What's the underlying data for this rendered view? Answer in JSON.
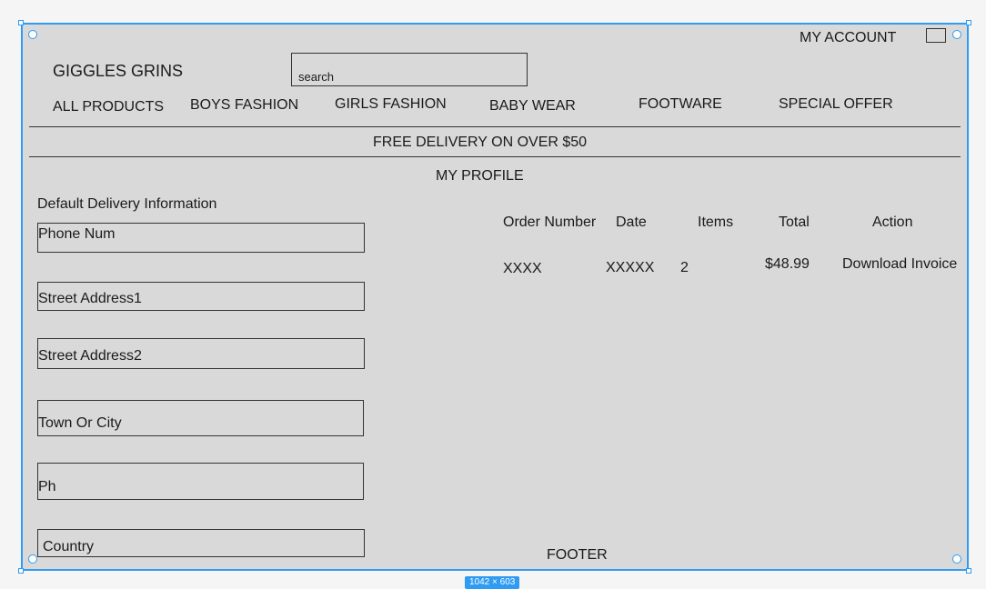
{
  "header": {
    "my_account": "MY ACCOUNT",
    "logo": "GIGGLES GRINS",
    "search_placeholder": "search"
  },
  "nav": {
    "items": [
      "ALL PRODUCTS",
      "BOYS FASHION",
      "GIRLS FASHION",
      "BABY WEAR",
      "FOOTWARE",
      "SPECIAL OFFER"
    ]
  },
  "banner": "FREE DELIVERY ON OVER $50",
  "profile": {
    "title": "MY PROFILE",
    "delivery_heading": "Default Delivery Information",
    "fields": [
      "Phone Num",
      "Street Address1",
      "Street Address2",
      "Town Or City",
      "Ph",
      "Country"
    ]
  },
  "orders": {
    "headers": [
      "Order Number",
      "Date",
      "Items",
      "Total",
      "Action"
    ],
    "rows": [
      {
        "order_number": "XXXX",
        "date": "XXXXX",
        "items": "2",
        "total": "$48.99",
        "action": "Download Invoice"
      }
    ]
  },
  "footer": "FOOTER",
  "icons": {
    "account": "account-box-icon"
  },
  "colors": {
    "selection": "#2f9bf2",
    "frame_bg": "#d9d9d9"
  }
}
